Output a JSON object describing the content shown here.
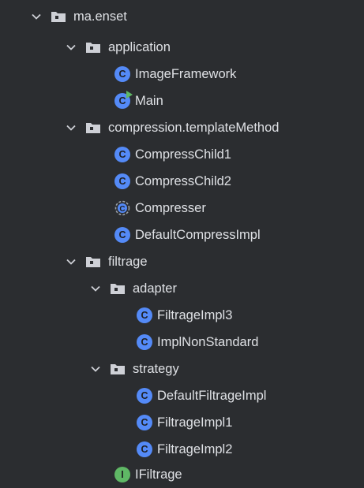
{
  "tree": {
    "root": {
      "label": "ma.enset",
      "icon": "package-folder-icon",
      "expanded": true
    },
    "application": {
      "label": "application",
      "icon": "package-folder-icon",
      "expanded": true,
      "items": [
        {
          "label": "ImageFramework",
          "icon": "class-icon"
        },
        {
          "label": "Main",
          "icon": "runnable-class-icon"
        }
      ]
    },
    "compression": {
      "label": "compression.templateMethod",
      "icon": "package-folder-icon",
      "expanded": true,
      "items": [
        {
          "label": "CompressChild1",
          "icon": "class-icon"
        },
        {
          "label": "CompressChild2",
          "icon": "class-icon"
        },
        {
          "label": "Compresser",
          "icon": "abstract-class-icon"
        },
        {
          "label": "DefaultCompressImpl",
          "icon": "class-icon"
        }
      ]
    },
    "filtrage": {
      "label": "filtrage",
      "icon": "package-folder-icon",
      "expanded": true,
      "adapter": {
        "label": "adapter",
        "icon": "package-folder-icon",
        "expanded": true,
        "items": [
          {
            "label": "FiltrageImpl3",
            "icon": "class-icon"
          },
          {
            "label": "ImplNonStandard",
            "icon": "class-icon"
          }
        ]
      },
      "strategy": {
        "label": "strategy",
        "icon": "package-folder-icon",
        "expanded": true,
        "items": [
          {
            "label": "DefaultFiltrageImpl",
            "icon": "class-icon"
          },
          {
            "label": "FiltrageImpl1",
            "icon": "class-icon"
          },
          {
            "label": "FiltrageImpl2",
            "icon": "class-icon"
          }
        ]
      },
      "items": [
        {
          "label": "IFiltrage",
          "icon": "interface-icon"
        }
      ]
    }
  },
  "icon_letters": {
    "class": "C",
    "interface": "I"
  },
  "colors": {
    "background": "#2b2d30",
    "text": "#dfe1e5",
    "class_icon": "#548af7",
    "interface_icon": "#5fb865",
    "folder_icon": "#ced0d6"
  }
}
